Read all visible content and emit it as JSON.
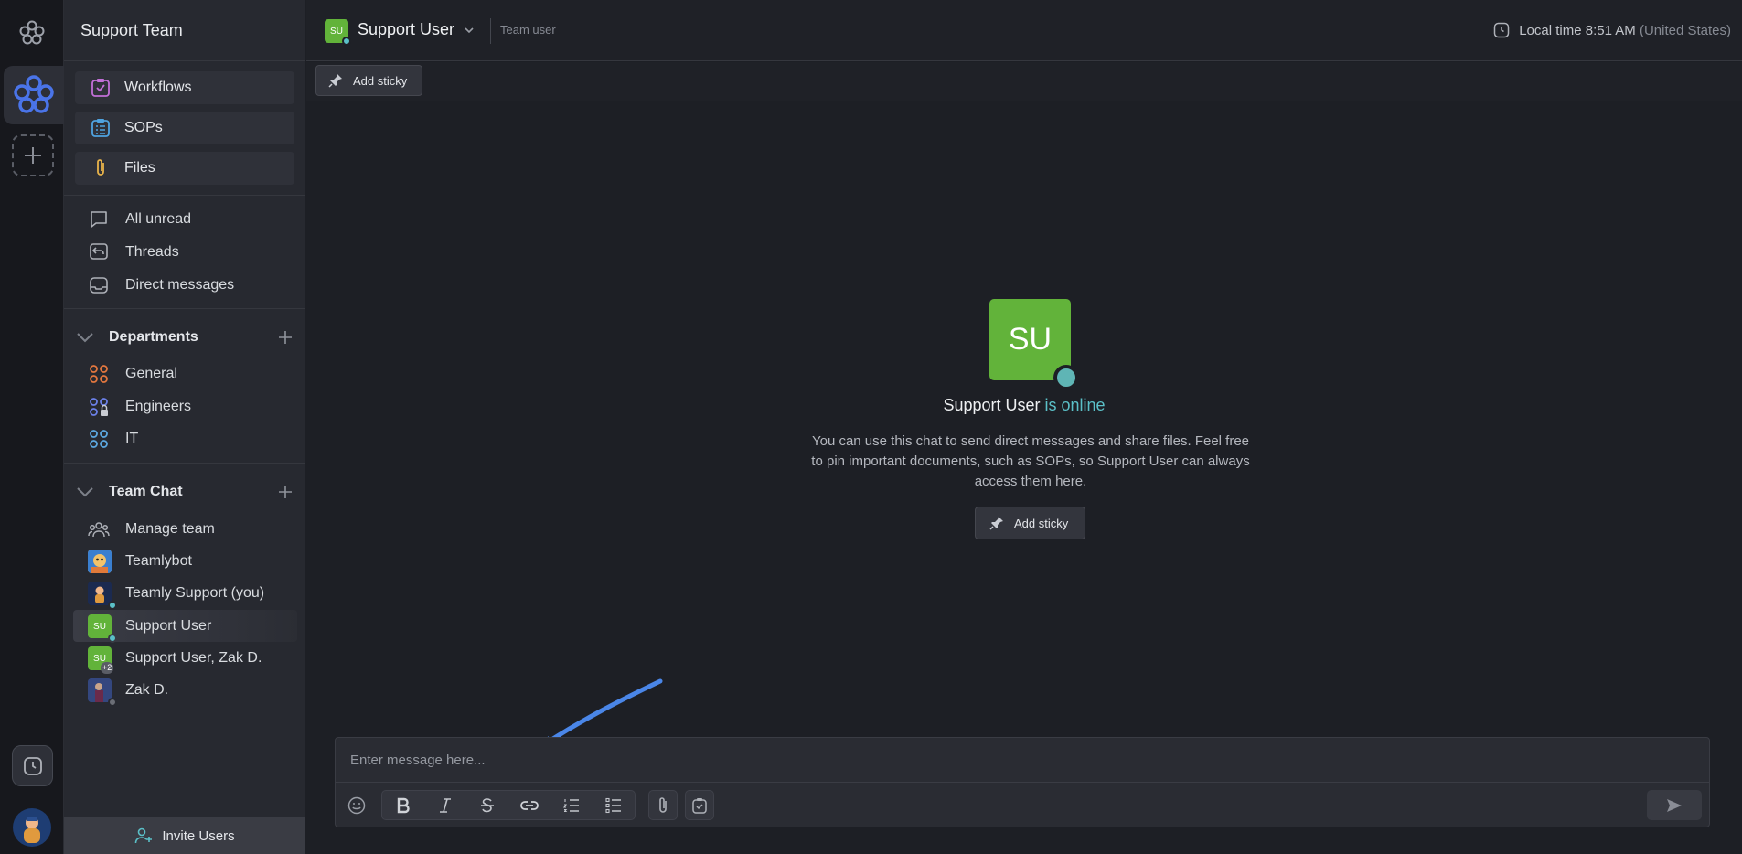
{
  "team": {
    "name": "Support Team"
  },
  "pinned": [
    {
      "label": "Workflows",
      "icon": "workflow-icon"
    },
    {
      "label": "SOPs",
      "icon": "sop-icon"
    },
    {
      "label": "Files",
      "icon": "paperclip-icon"
    }
  ],
  "views": [
    {
      "label": "All unread",
      "icon": "chat-bubble-icon"
    },
    {
      "label": "Threads",
      "icon": "threads-icon"
    },
    {
      "label": "Direct messages",
      "icon": "inbox-icon"
    }
  ],
  "departments": {
    "title": "Departments",
    "items": [
      {
        "label": "General",
        "icon": "channel-icon",
        "color": "#e2773f"
      },
      {
        "label": "Engineers",
        "icon": "channel-lock-icon",
        "color": "#6b80e8"
      },
      {
        "label": "IT",
        "icon": "channel-icon",
        "color": "#5ca8e0"
      }
    ]
  },
  "team_chat": {
    "title": "Team Chat",
    "items": [
      {
        "label": "Manage team",
        "icon": "people-icon"
      },
      {
        "label": "Teamlybot",
        "icon": "bot-avatar"
      },
      {
        "label": "Teamly Support (you)",
        "icon": "user-avatar"
      },
      {
        "label": "Support User",
        "avatar_text": "SU",
        "active": true
      },
      {
        "label": "Support User, Zak D.",
        "avatar_text": "SU",
        "badge": "+2"
      },
      {
        "label": "Zak D.",
        "icon": "user-avatar"
      }
    ]
  },
  "invite": {
    "label": "Invite Users"
  },
  "header": {
    "avatar_text": "SU",
    "name": "Support User",
    "role": "Team user",
    "time_label": "Local time 8:51 AM",
    "time_region": "(United States)"
  },
  "sticky": {
    "label": "Add sticky"
  },
  "empty_state": {
    "avatar_text": "SU",
    "name": "Support User",
    "status": "is online",
    "description": "You can use this chat to send direct messages and share files. Feel free to pin important documents, such as SOPs, so Support User can always access them here.",
    "button": "Add sticky"
  },
  "composer": {
    "placeholder": "Enter message here...",
    "tools": [
      "emoji-icon",
      "bold-icon",
      "italic-icon",
      "strikethrough-icon",
      "link-icon",
      "numbered-list-icon",
      "bullet-list-icon",
      "attach-icon",
      "task-icon",
      "send-icon"
    ]
  },
  "colors": {
    "accent": "#4a74e8",
    "online": "#5bc0c8",
    "avatar_green": "#62b33a"
  }
}
